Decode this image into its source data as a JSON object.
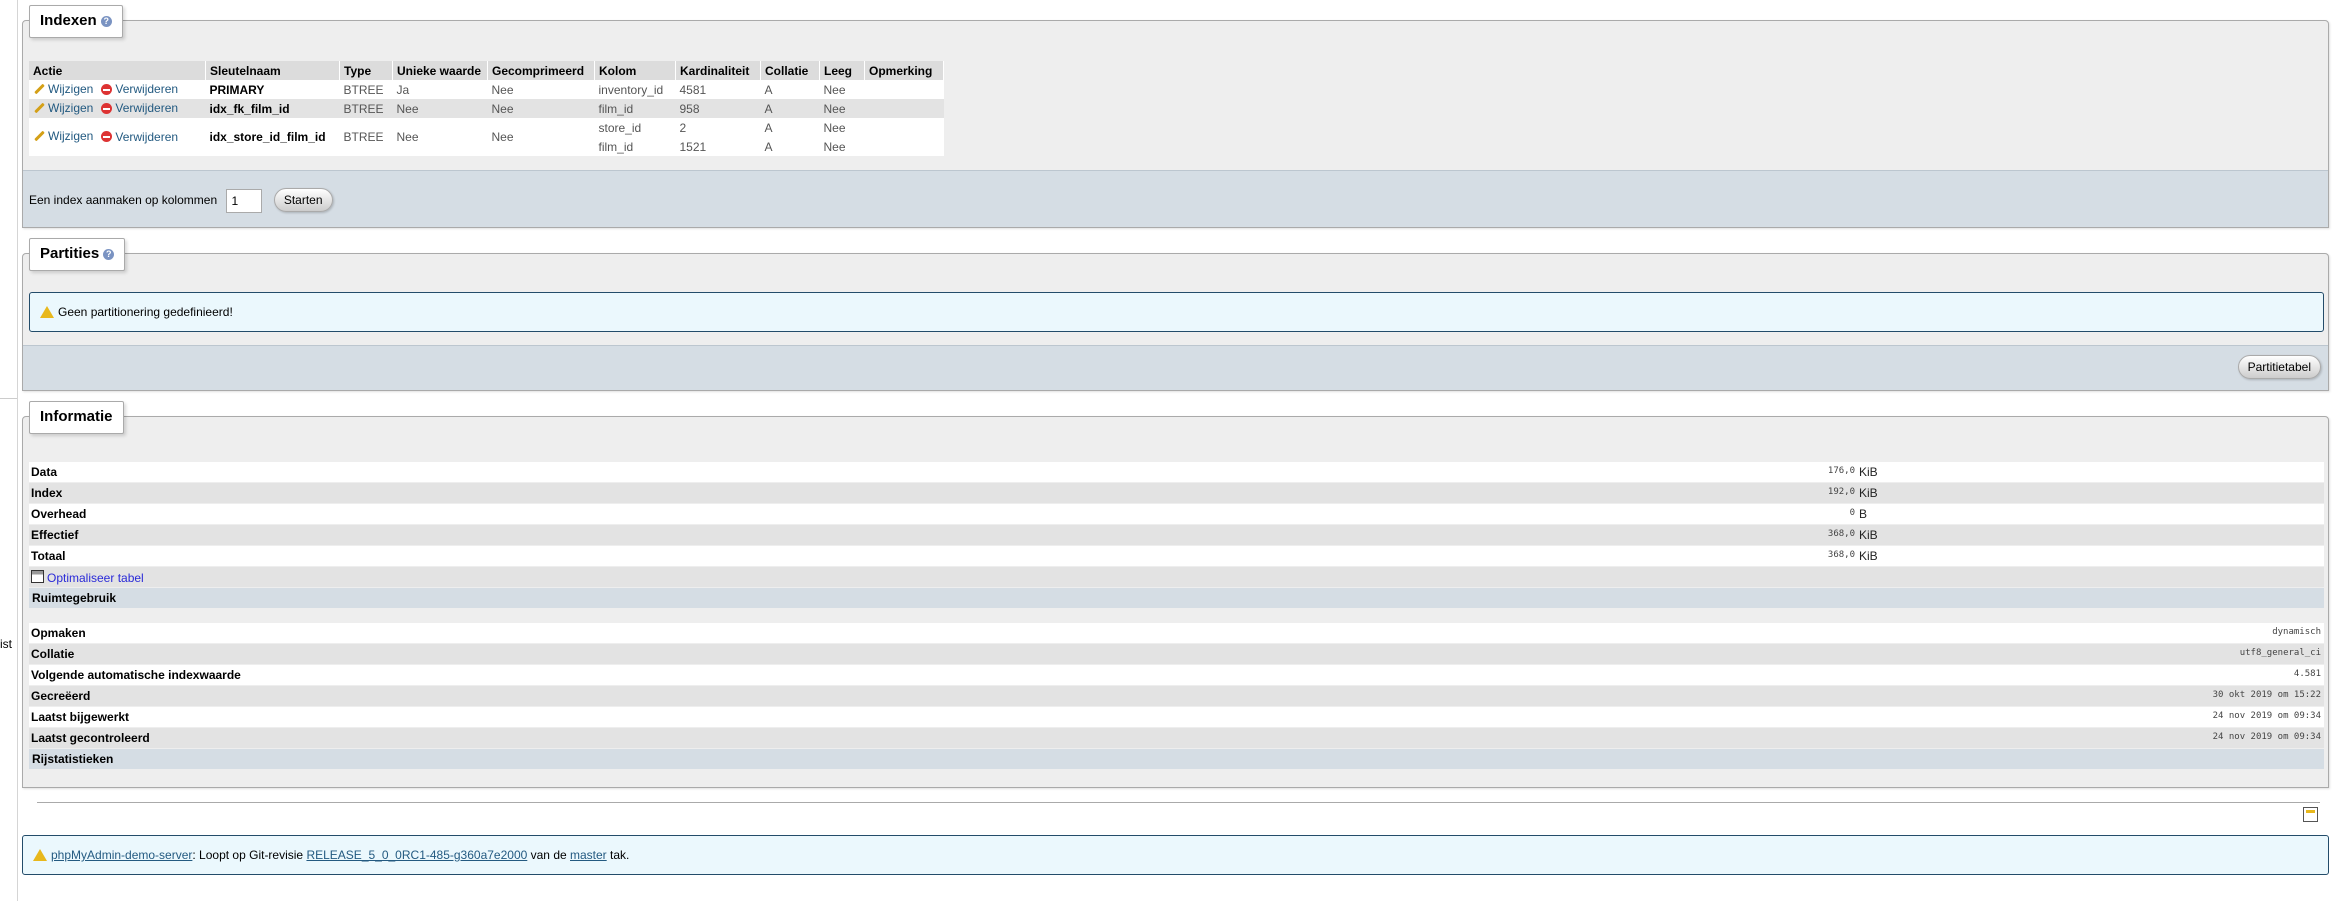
{
  "left_strip": {
    "stub_text": "ist"
  },
  "indexes": {
    "title": "Indexen",
    "columns": [
      "Actie",
      "Sleutelnaam",
      "Type",
      "Unieke waarde",
      "Gecomprimeerd",
      "Kolom",
      "Kardinaliteit",
      "Collatie",
      "Leeg",
      "Opmerking"
    ],
    "edit_label": "Wijzigen",
    "drop_label": "Verwijderen",
    "rows": [
      {
        "key": "PRIMARY",
        "type": "BTREE",
        "unique": "Ja",
        "packed": "Nee",
        "column": "inventory_id",
        "cardinality": "4581",
        "collation": "A",
        "null": "Nee",
        "comment": ""
      },
      {
        "key": "idx_fk_film_id",
        "type": "BTREE",
        "unique": "Nee",
        "packed": "Nee",
        "column": "film_id",
        "cardinality": "958",
        "collation": "A",
        "null": "Nee",
        "comment": ""
      },
      {
        "key": "idx_store_id_film_id",
        "type": "BTREE",
        "unique": "Nee",
        "packed": "Nee",
        "column": "store_id",
        "cardinality": "2",
        "collation": "A",
        "null": "Nee",
        "comment": "",
        "column2": "film_id",
        "cardinality2": "1521",
        "collation2": "A",
        "null2": "Nee"
      }
    ],
    "create_label": "Een index aanmaken op kolommen",
    "create_value": "1",
    "start_button": "Starten"
  },
  "partitions": {
    "title": "Partities",
    "notice": "Geen partitionering gedefinieerd!",
    "button": "Partitietabel"
  },
  "info": {
    "title": "Informatie",
    "space": [
      {
        "label": "Data",
        "value": "176,0",
        "unit": "KiB"
      },
      {
        "label": "Index",
        "value": "192,0",
        "unit": "KiB"
      },
      {
        "label": "Overhead",
        "value": "0",
        "unit": "B"
      },
      {
        "label": "Effectief",
        "value": "368,0",
        "unit": "KiB"
      },
      {
        "label": "Totaal",
        "value": "368,0",
        "unit": "KiB"
      }
    ],
    "optimize_link": "Optimaliseer tabel",
    "space_caption": "Ruimtegebruik",
    "rows": [
      {
        "label": "Opmaken",
        "value": "dynamisch"
      },
      {
        "label": "Collatie",
        "value": "utf8_general_ci"
      },
      {
        "label": "Volgende automatische indexwaarde",
        "value": "4.581"
      },
      {
        "label": "Gecreëerd",
        "value": "30 okt 2019 om 15:22"
      },
      {
        "label": "Laatst bijgewerkt",
        "value": "24 nov 2019 om 09:34"
      },
      {
        "label": "Laatst gecontroleerd",
        "value": "24 nov 2019 om 09:34"
      }
    ],
    "row_caption": "Rijstatistieken"
  },
  "footer": {
    "server_link": "phpMyAdmin-demo-server",
    "text1": ": Loopt op Git-revisie ",
    "revision_link": "RELEASE_5_0_0RC1-485-g360a7e2000",
    "text2": " van de ",
    "branch_link": "master",
    "text3": " tak."
  }
}
